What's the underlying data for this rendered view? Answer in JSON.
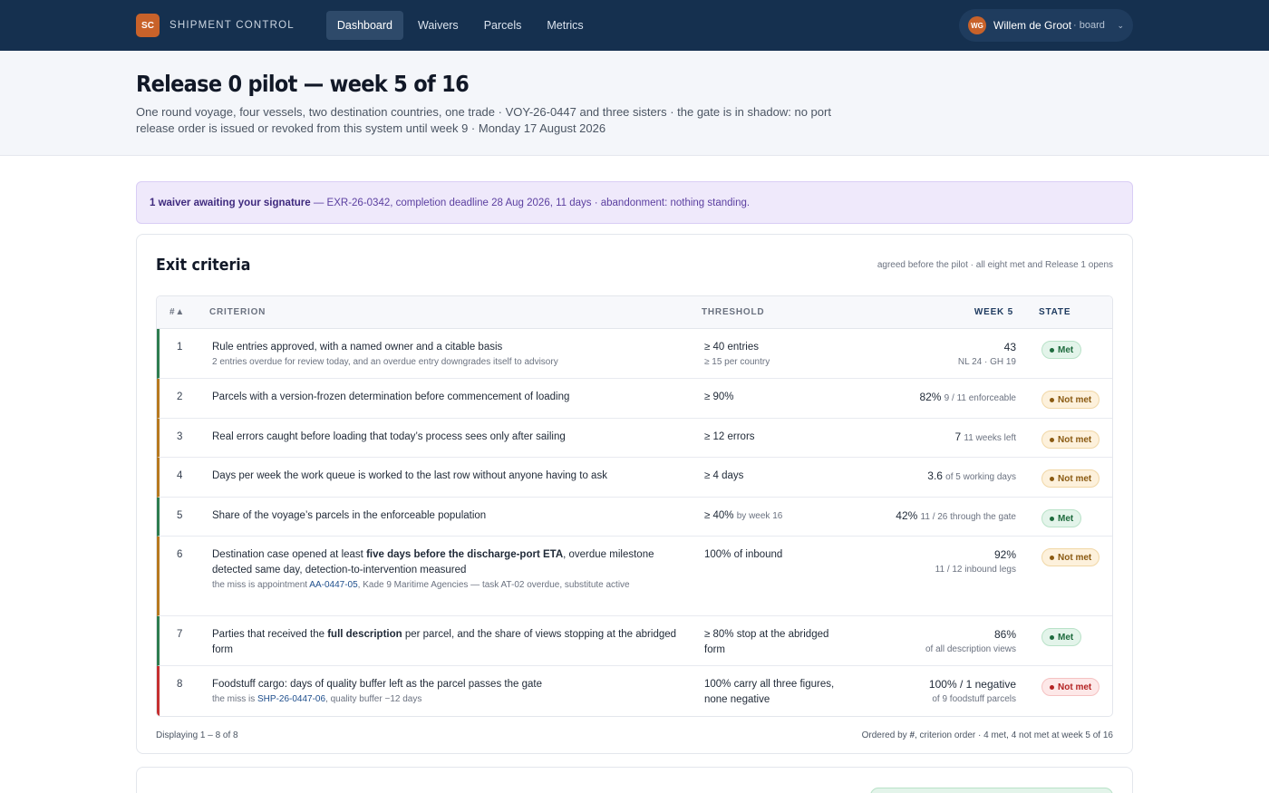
{
  "nav": {
    "brand_initials": "SC",
    "brand_name": "SHIPMENT CONTROL",
    "items": [
      "Dashboard",
      "Waivers",
      "Parcels",
      "Metrics"
    ],
    "user": {
      "initials": "WG",
      "name": "Willem de Groot",
      "role": "· board"
    }
  },
  "header": {
    "title": "Release 0 pilot — week 5 of 16",
    "subtitle": "One round voyage, four vessels, two destination countries, one trade · VOY-26-0447 and three sisters · the gate is in shadow: no port release order is issued or revoked from this system until week 9 · Monday 17 August 2026"
  },
  "banner": {
    "strong": "1 waiver awaiting your signature",
    "text": " — EXR-26-0342, completion deadline 28 Aug 2026, 11 days · abandonment: nothing standing."
  },
  "exit": {
    "title": "Exit criteria",
    "note": "agreed before the pilot · all eight met and Release 1 opens",
    "columns": {
      "num": "#▲",
      "criterion": "CRITERION",
      "threshold": "THRESHOLD",
      "week": "WEEK 5",
      "state": "STATE"
    },
    "rows": [
      {
        "n": "1",
        "crit": "Rule entries approved, with a named owner and a citable basis",
        "crit_sub": "2 entries overdue for review today, and an overdue entry downgrades itself to advisory",
        "thr": "≥ 40 entries",
        "thr_sub": "≥ 15 per country",
        "week": "43",
        "week_sub": "NL 24 · GH 19",
        "state": "Met"
      },
      {
        "n": "2",
        "crit": "Parcels with a version-frozen determination before commencement of loading",
        "thr": "≥ 90%",
        "week": "82%",
        "week_note": "9 / 11 enforceable",
        "state": "Not met"
      },
      {
        "n": "3",
        "crit": "Real errors caught before loading that today’s process sees only after sailing",
        "thr": "≥ 12 errors",
        "week": "7",
        "week_note": "11 weeks left",
        "state": "Not met"
      },
      {
        "n": "4",
        "crit": "Days per week the work queue is worked to the last row without anyone having to ask",
        "thr": "≥ 4 days",
        "week": "3.6",
        "week_note": "of 5 working days",
        "state": "Not met"
      },
      {
        "n": "5",
        "crit": "Share of the voyage’s parcels in the enforceable population",
        "thr": "≥ 40%",
        "thr_note": "by week 16",
        "week": "42%",
        "week_note": "11 / 26 through the gate",
        "state": "Met"
      },
      {
        "n": "6",
        "crit_a": "Destination case opened at least ",
        "crit_b": "five days before the discharge-port ETA",
        "crit_c": ", overdue milestone detected same day, detection-to-intervention measured",
        "sub_a": "the miss is appointment ",
        "sub_link": "AA-0447-05",
        "sub_b": ", Kade 9 Maritime Agencies — task AT-02 overdue, substitute active",
        "thr": "100% of inbound",
        "week": "92%",
        "week_sub": "11 / 12 inbound legs",
        "state": "Not met"
      },
      {
        "n": "7",
        "crit_a": "Parties that received the ",
        "crit_b": "full description",
        "crit_c": " per parcel, and the share of views stopping at the abridged form",
        "thr": "≥ 80% stop at the abridged form",
        "week": "86%",
        "week_sub": "of all description views",
        "state": "Met"
      },
      {
        "n": "8",
        "crit": "Foodstuff cargo: days of quality buffer left as the parcel passes the gate",
        "sub_a": "the miss is ",
        "sub_link": "SHP-26-0447-06",
        "sub_b": ", quality buffer −12 days",
        "thr": "100% carry all three figures, none negative",
        "week": "100% / 1 negative",
        "week_sub": "of 9 foodstuff parcels",
        "state": "Not met"
      }
    ],
    "footer_left": "Displaying 1 – 8 of 8",
    "footer_right_a": "Ordered by ",
    "footer_right_b": "#",
    "footer_right_c": ", criterion order · 4 met, 4 not met at week 5 of 16"
  }
}
